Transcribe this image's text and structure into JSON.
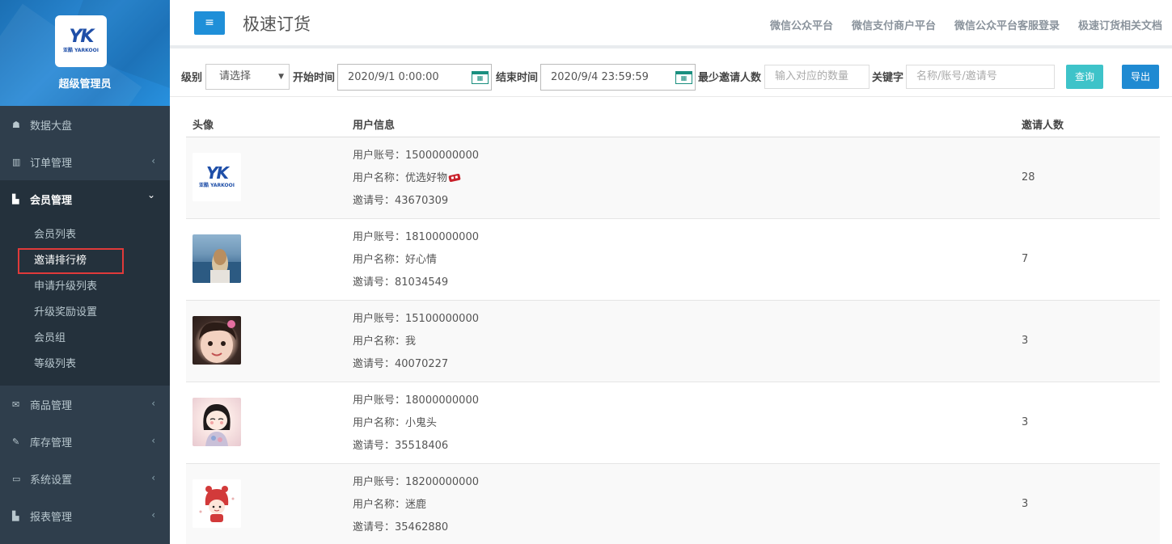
{
  "sidebar": {
    "logo_mark": "YK",
    "logo_sub": "亚酷 YARKOOI",
    "title": "超级管理员",
    "items": [
      {
        "icon": "home-icon",
        "glyph": "☗",
        "label": "数据大盘",
        "arrow": ""
      },
      {
        "icon": "columns-icon",
        "glyph": "▥",
        "label": "订单管理",
        "arrow": "‹"
      },
      {
        "icon": "bar-chart-icon",
        "glyph": "▙",
        "label": "会员管理",
        "arrow": "⌄"
      }
    ],
    "sub_items": [
      "会员列表",
      "邀请排行榜",
      "申请升级列表",
      "升级奖励设置",
      "会员组",
      "等级列表"
    ],
    "items_after": [
      {
        "icon": "envelope-icon",
        "glyph": "✉",
        "label": "商品管理",
        "arrow": "‹"
      },
      {
        "icon": "edit-icon",
        "glyph": "✎",
        "label": "库存管理",
        "arrow": "‹"
      },
      {
        "icon": "monitor-icon",
        "glyph": "▭",
        "label": "系统设置",
        "arrow": "‹"
      },
      {
        "icon": "bar-chart-icon",
        "glyph": "▙",
        "label": "报表管理",
        "arrow": "‹"
      }
    ]
  },
  "header": {
    "menu_glyph": "≡",
    "title": "极速订货",
    "links": [
      "微信公众平台",
      "微信支付商户平台",
      "微信公众平台客服登录",
      "极速订货相关文档"
    ]
  },
  "filter": {
    "level_label": "级别",
    "level_value": "请选择",
    "start_label": "开始时间",
    "start_value": "2020/9/1 0:00:00",
    "end_label": "结束时间",
    "end_value": "2020/9/4 23:59:59",
    "min_label": "最少邀请人数",
    "min_placeholder": "输入对应的数量",
    "keyword_label": "关键字",
    "keyword_placeholder": "名称/账号/邀请号",
    "query_label": "查询",
    "export_label": "导出"
  },
  "table": {
    "headers": {
      "avatar": "头像",
      "info": "用户信息",
      "count": "邀请人数"
    },
    "account_prefix": "用户账号：",
    "name_prefix": "用户名称：",
    "code_prefix": "邀请号：",
    "rows": [
      {
        "avatar": "logo",
        "account": "15000000000",
        "name": "优选好物",
        "code": "43670309",
        "count": "28"
      },
      {
        "avatar": "sea",
        "account": "18100000000",
        "name": "好心情",
        "code": "81034549",
        "count": "7"
      },
      {
        "avatar": "girl",
        "account": "15100000000",
        "name": "我",
        "code": "40070227",
        "count": "3"
      },
      {
        "avatar": "cartoon",
        "account": "18000000000",
        "name": "小鬼头",
        "code": "35518406",
        "count": "3"
      },
      {
        "avatar": "red",
        "account": "18200000000",
        "name": "迷鹿",
        "code": "35462880",
        "count": "3"
      }
    ]
  },
  "colors": {
    "sidebar_bg": "#2f3e4c",
    "brand_blue": "#1f7ac4",
    "accent_blue": "#1f8fd8",
    "query_teal": "#3ec3c9",
    "highlight_red": "#e03a3a"
  }
}
